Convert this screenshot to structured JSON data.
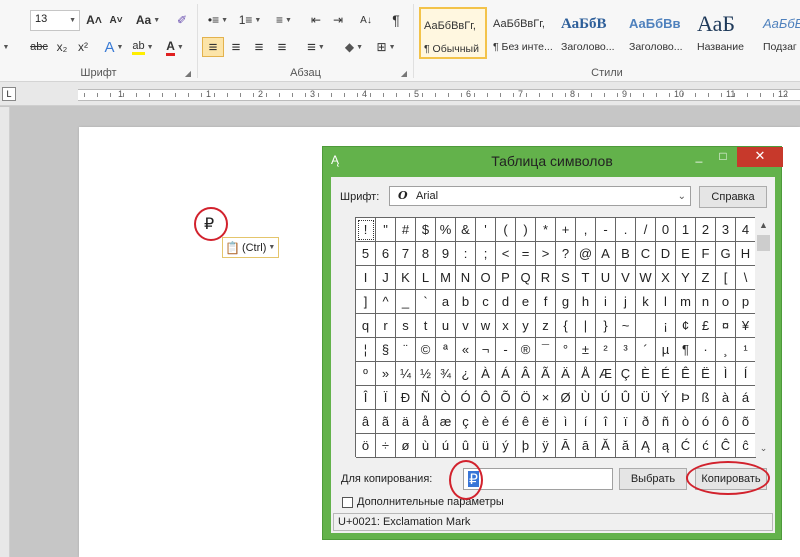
{
  "ribbon": {
    "font_size_value": "13",
    "font_group_label": "Шрифт",
    "paragraph_group_label": "Абзац",
    "styles_group_label": "Стили",
    "font_buttons_row1": [
      {
        "icon": "grow-font-icon",
        "glyph": "A˄"
      },
      {
        "icon": "shrink-font-icon",
        "glyph": "A˅"
      },
      {
        "icon": "change-case-icon",
        "glyph": "Aa"
      },
      {
        "icon": "clear-formatting-icon",
        "glyph": "✐"
      }
    ],
    "font_buttons_row2": [
      {
        "icon": "strikethrough-icon",
        "glyph": "abc"
      },
      {
        "icon": "subscript-icon",
        "glyph": "x₂"
      },
      {
        "icon": "superscript-icon",
        "glyph": "x²"
      },
      {
        "icon": "text-effects-icon",
        "glyph": "A"
      },
      {
        "icon": "highlight-icon",
        "glyph": "ab"
      },
      {
        "icon": "font-color-icon",
        "glyph": "A"
      }
    ],
    "paragraph_buttons_row1": [
      {
        "icon": "bullets-icon",
        "glyph": "•≡"
      },
      {
        "icon": "numbering-icon",
        "glyph": "1≡"
      },
      {
        "icon": "multilevel-list-icon",
        "glyph": "≡"
      },
      {
        "icon": "decrease-indent-icon",
        "glyph": "⇤"
      },
      {
        "icon": "increase-indent-icon",
        "glyph": "⇥"
      },
      {
        "icon": "sort-icon",
        "glyph": "A↓"
      },
      {
        "icon": "show-marks-icon",
        "glyph": "¶"
      }
    ],
    "paragraph_buttons_row2": [
      {
        "icon": "align-left-icon",
        "glyph": "≡"
      },
      {
        "icon": "align-center-icon",
        "glyph": "≡"
      },
      {
        "icon": "align-right-icon",
        "glyph": "≡"
      },
      {
        "icon": "justify-icon",
        "glyph": "≡"
      },
      {
        "icon": "line-spacing-icon",
        "glyph": "≡"
      },
      {
        "icon": "shading-icon",
        "glyph": "◆"
      },
      {
        "icon": "borders-icon",
        "glyph": "⊞"
      }
    ],
    "styles": [
      {
        "sample": "АаБбВвГг,",
        "name": "¶ Обычный",
        "selected": true
      },
      {
        "sample": "АаБбВвГг,",
        "name": "¶ Без инте...",
        "selected": false
      },
      {
        "sample": "АаБбВ",
        "name": "Заголово...",
        "selected": false
      },
      {
        "sample": "АаБбВв",
        "name": "Заголово...",
        "selected": false
      },
      {
        "sample": "АаБ",
        "name": "Название",
        "selected": false
      },
      {
        "sample": "АаБбВ",
        "name": "Подзаг",
        "selected": false
      }
    ]
  },
  "ruler": {
    "tab_selector": "L",
    "numbers": [
      "1",
      "1",
      "2",
      "3",
      "4",
      "5",
      "6",
      "7",
      "8",
      "9",
      "10",
      "11",
      "12",
      "13"
    ]
  },
  "document": {
    "inserted_char": "₽",
    "paste_options_label": "(Ctrl)"
  },
  "charmap": {
    "title": "Таблица символов",
    "font_label": "Шрифт:",
    "font_value": "Arial",
    "help_button": "Справка",
    "grid": [
      [
        "!",
        "\"",
        "#",
        "$",
        "%",
        "&",
        "'",
        "(",
        ")",
        "*",
        "+",
        ",",
        "-",
        ".",
        "/",
        "0",
        "1",
        "2",
        "3",
        "4"
      ],
      [
        "5",
        "6",
        "7",
        "8",
        "9",
        ":",
        ";",
        "<",
        "=",
        ">",
        "?",
        "@",
        "A",
        "B",
        "C",
        "D",
        "E",
        "F",
        "G",
        "H"
      ],
      [
        "I",
        "J",
        "K",
        "L",
        "M",
        "N",
        "O",
        "P",
        "Q",
        "R",
        "S",
        "T",
        "U",
        "V",
        "W",
        "X",
        "Y",
        "Z",
        "[",
        "\\"
      ],
      [
        "]",
        "^",
        "_",
        "`",
        "a",
        "b",
        "c",
        "d",
        "e",
        "f",
        "g",
        "h",
        "i",
        "j",
        "k",
        "l",
        "m",
        "n",
        "o",
        "p"
      ],
      [
        "q",
        "r",
        "s",
        "t",
        "u",
        "v",
        "w",
        "x",
        "y",
        "z",
        "{",
        "|",
        "}",
        "~",
        " ",
        "¡",
        "¢",
        "£",
        "¤",
        "¥"
      ],
      [
        "¦",
        "§",
        "¨",
        "©",
        "ª",
        "«",
        "¬",
        "-",
        "®",
        "¯",
        "°",
        "±",
        "²",
        "³",
        "´",
        "µ",
        "¶",
        "·",
        "¸",
        "¹"
      ],
      [
        "º",
        "»",
        "¼",
        "½",
        "¾",
        "¿",
        "À",
        "Á",
        "Â",
        "Ã",
        "Ä",
        "Å",
        "Æ",
        "Ç",
        "È",
        "É",
        "Ê",
        "Ë",
        "Ì",
        "Í"
      ],
      [
        "Î",
        "Ï",
        "Ð",
        "Ñ",
        "Ò",
        "Ó",
        "Ô",
        "Õ",
        "Ö",
        "×",
        "Ø",
        "Ù",
        "Ú",
        "Û",
        "Ü",
        "Ý",
        "Þ",
        "ß",
        "à",
        "á"
      ],
      [
        "â",
        "ã",
        "ä",
        "å",
        "æ",
        "ç",
        "è",
        "é",
        "ê",
        "ë",
        "ì",
        "í",
        "î",
        "ï",
        "ð",
        "ñ",
        "ò",
        "ó",
        "ô",
        "õ"
      ],
      [
        "ö",
        "÷",
        "ø",
        "ù",
        "ú",
        "û",
        "ü",
        "ý",
        "þ",
        "ÿ",
        "Ā",
        "ā",
        "Ă",
        "ă",
        "Ą",
        "ą",
        "Ć",
        "ć",
        "Ĉ",
        "ĉ"
      ]
    ],
    "copy_label": "Для копирования:",
    "copy_value": "₽",
    "select_button": "Выбрать",
    "copy_button": "Копировать",
    "advanced_label": "Дополнительные параметры",
    "status_text": "U+0021: Exclamation Mark"
  },
  "colors": {
    "titlebar_green": "#63b24b",
    "close_red": "#c7392b",
    "annotation_red": "#d2222d",
    "ribbon_active": "#fce4a8"
  }
}
